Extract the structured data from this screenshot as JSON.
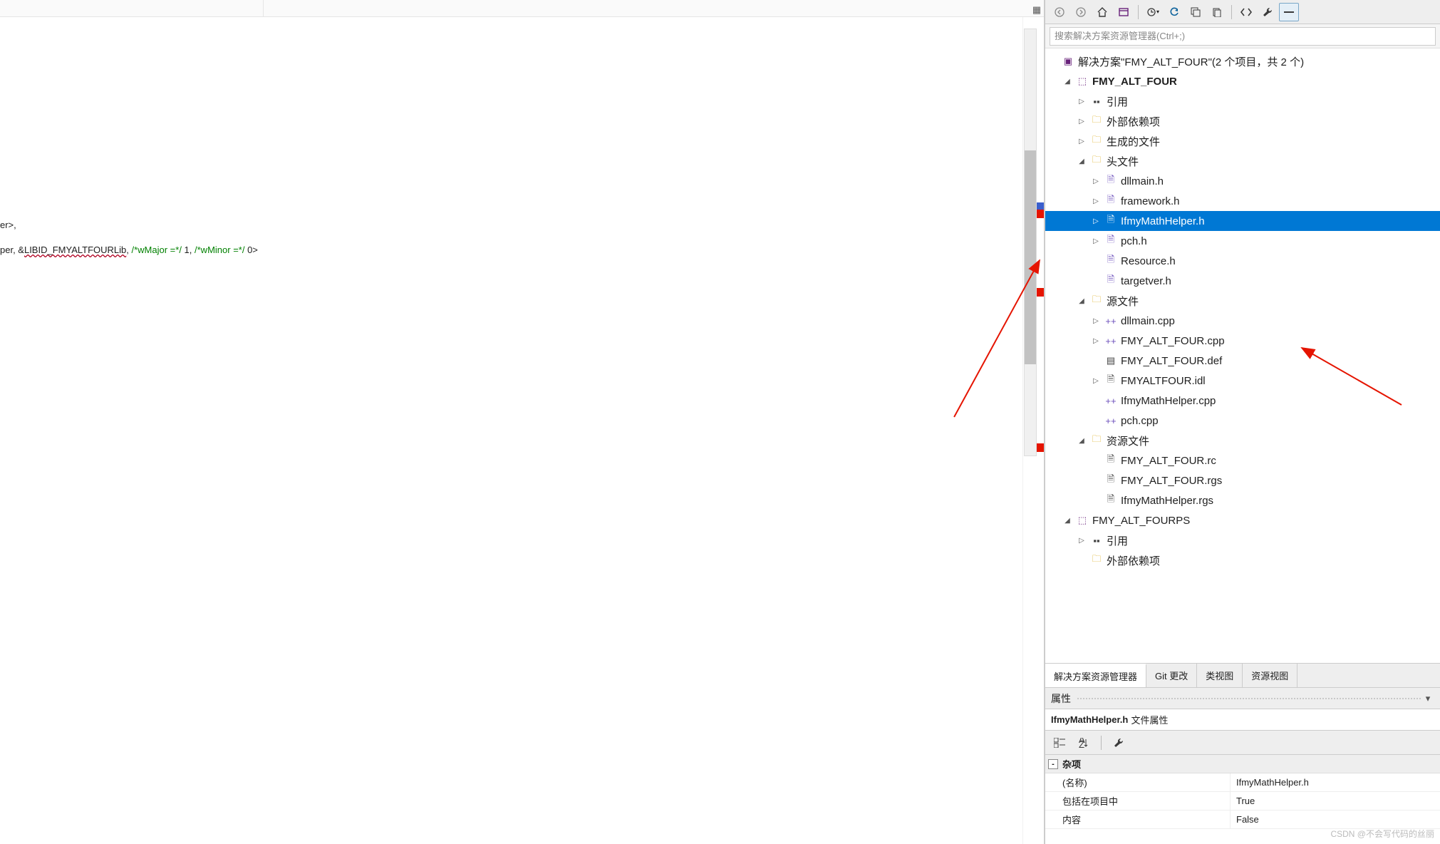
{
  "editor": {
    "line1": "er>,",
    "line2_a": "per, &",
    "line2_lib": "LIBID_FMYALTFOURLib",
    "line2_b": ", ",
    "line2_c1": "/*wMajor =*/",
    "line2_d": " 1, ",
    "line2_c2": "/*wMinor =*/",
    "line2_e": " 0>"
  },
  "toolbar": {
    "back": "←",
    "forward": "→",
    "home": "⌂",
    "vs": "VS",
    "refresh": "⟳"
  },
  "search": {
    "placeholder": "搜索解决方案资源管理器(Ctrl+;)"
  },
  "tree": {
    "solution": "解决方案\"FMY_ALT_FOUR\"(2 个项目，共 2 个)",
    "proj1": "FMY_ALT_FOUR",
    "ref": "引用",
    "ext": "外部依赖项",
    "gen": "生成的文件",
    "hdr": "头文件",
    "h_dllmain": "dllmain.h",
    "h_framework": "framework.h",
    "h_ifmy": "IfmyMathHelper.h",
    "h_pch": "pch.h",
    "h_res": "Resource.h",
    "h_targ": "targetver.h",
    "src": "源文件",
    "c_dllmain": "dllmain.cpp",
    "c_four": "FMY_ALT_FOUR.cpp",
    "c_def": "FMY_ALT_FOUR.def",
    "c_idl": "FMYALTFOUR.idl",
    "c_ifmy": "IfmyMathHelper.cpp",
    "c_pch": "pch.cpp",
    "res": "资源文件",
    "r_rc": "FMY_ALT_FOUR.rc",
    "r_rgs": "FMY_ALT_FOUR.rgs",
    "r_irgs": "IfmyMathHelper.rgs",
    "proj2": "FMY_ALT_FOURPS",
    "ref2": "引用",
    "ext2": "外部依赖项"
  },
  "tabs": {
    "t1": "解决方案资源管理器",
    "t2": "Git 更改",
    "t3": "类视图",
    "t4": "资源视图"
  },
  "props": {
    "title": "属性",
    "sub_name": "IfmyMathHelper.h",
    "sub_kind": "文件属性",
    "cat": "杂项",
    "k_name": "(名称)",
    "v_name": "IfmyMathHelper.h",
    "k_incl": "包括在项目中",
    "v_incl": "True",
    "k_cont": "内容",
    "v_cont": "False"
  },
  "watermark": "CSDN @不会写代码的丝丽"
}
